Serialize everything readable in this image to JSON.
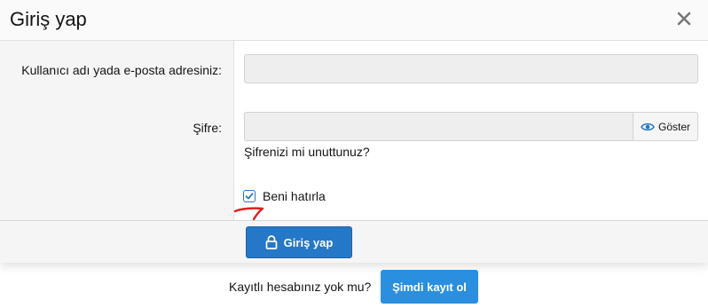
{
  "dialog": {
    "title": "Giriş yap"
  },
  "form": {
    "username_label": "Kullanıcı adı yada e-posta adresiniz:",
    "username_value": "",
    "password_label": "Şifre:",
    "password_value": "",
    "show_label": "Göster",
    "forgot_label": "Şifrenizi mi unuttunuz?",
    "remember_label": "Beni hatırla",
    "remember_checked": true
  },
  "footer": {
    "login_label": "Giriş yap"
  },
  "register": {
    "prompt": "Kayıtlı hesabınız yok mu?",
    "button_label": "Şimdi kayıt ol"
  },
  "colors": {
    "primary": "#2577c8",
    "register": "#2b8fdf",
    "annotation": "#e02020"
  },
  "icons": {
    "close": "close-icon",
    "eye": "eye-icon",
    "check": "check-icon",
    "lock": "lock-icon"
  }
}
